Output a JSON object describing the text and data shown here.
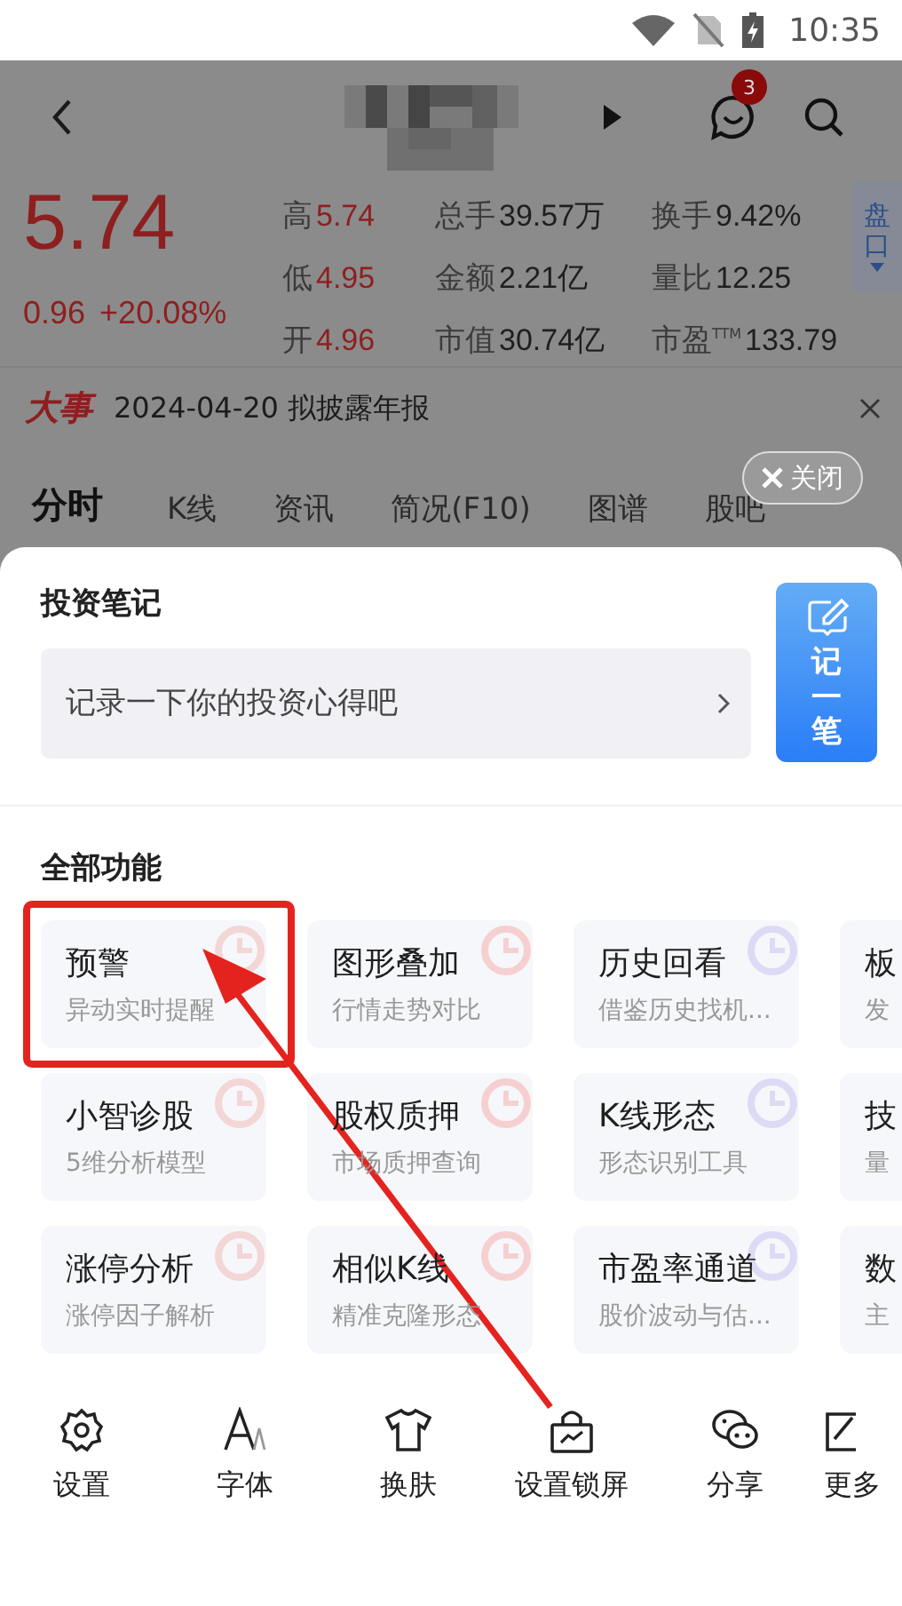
{
  "status_bar": {
    "time": "10:35"
  },
  "header": {
    "message_badge": "3"
  },
  "quote": {
    "price": "5.74",
    "change": "0.96",
    "change_pct": "+20.08%",
    "stats": [
      {
        "label": "高",
        "value": "5.74",
        "color": "#8e1f1f"
      },
      {
        "label": "总手",
        "value": "39.57万",
        "color": "#1f1f1f"
      },
      {
        "label": "换手",
        "value": "9.42%",
        "color": "#1f1f1f"
      },
      {
        "label": "低",
        "value": "4.95",
        "color": "#8e1f1f"
      },
      {
        "label": "金额",
        "value": "2.21亿",
        "color": "#1f1f1f"
      },
      {
        "label": "量比",
        "value": "12.25",
        "color": "#1f1f1f"
      },
      {
        "label": "开",
        "value": "4.96",
        "color": "#8e1f1f"
      },
      {
        "label": "市值",
        "value": "30.74亿",
        "color": "#1f1f1f"
      },
      {
        "label": "市盈$^{TTM}$",
        "value": "133.79",
        "color": "#1f1f1f"
      }
    ],
    "side_button": "盘口"
  },
  "event": {
    "tag": "大事",
    "text": "2024-04-20 拟披露年报"
  },
  "tabs": [
    {
      "label": "分时",
      "selected": true
    },
    {
      "label": "K线",
      "selected": false
    },
    {
      "label": "资讯",
      "selected": false
    },
    {
      "label": "简况(F10)",
      "selected": false
    },
    {
      "label": "图谱",
      "selected": false
    },
    {
      "label": "股吧",
      "selected": false
    }
  ],
  "close_button": "关闭",
  "sheet": {
    "notes_title": "投资笔记",
    "notes_placeholder": "记录一下你的投资心得吧",
    "note_button": "记一笔",
    "features_title": "全部功能",
    "features": [
      {
        "title": "预警",
        "subtitle": "异动实时提醒"
      },
      {
        "title": "图形叠加",
        "subtitle": "行情走势对比"
      },
      {
        "title": "历史回看",
        "subtitle": "借鉴历史找机..."
      },
      {
        "title": "板",
        "subtitle": "发"
      },
      {
        "title": "小智诊股",
        "subtitle": "5维分析模型"
      },
      {
        "title": "股权质押",
        "subtitle": "市场质押查询"
      },
      {
        "title": "K线形态",
        "subtitle": "形态识别工具"
      },
      {
        "title": "技",
        "subtitle": "量"
      },
      {
        "title": "涨停分析",
        "subtitle": "涨停因子解析"
      },
      {
        "title": "相似K线",
        "subtitle": "精准克隆形态"
      },
      {
        "title": "市盈率通道",
        "subtitle": "股价波动与估..."
      },
      {
        "title": "数",
        "subtitle": "主"
      }
    ],
    "actions": [
      {
        "label": "设置"
      },
      {
        "label": "字体"
      },
      {
        "label": "换肤"
      },
      {
        "label": "设置锁屏"
      },
      {
        "label": "分享"
      },
      {
        "label": "更多"
      }
    ]
  }
}
